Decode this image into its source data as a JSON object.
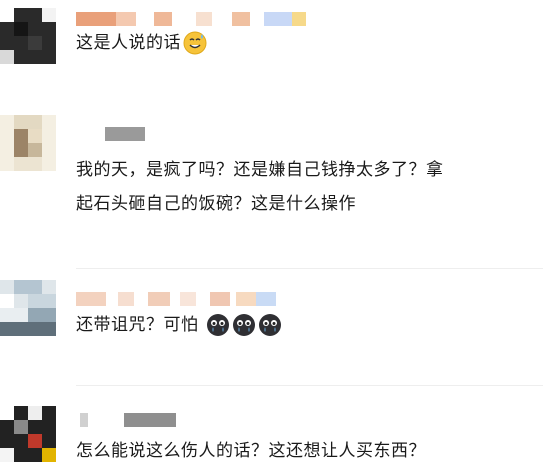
{
  "comments": [
    {
      "text": "这是人说的话",
      "emojis": [
        "sweat-smile-emoji"
      ]
    },
    {
      "lines": [
        "我的天，是疯了吗？还是嫌自己钱挣太多了？拿",
        "起石头砸自己的饭碗？这是什么操作"
      ],
      "emojis": []
    },
    {
      "text": "还带诅咒？可怕",
      "emojis": [
        "crying-ghost-emoji",
        "crying-ghost-emoji",
        "crying-ghost-emoji"
      ]
    },
    {
      "text": "怎么能说这么伤人的话？这还想让人买东西？",
      "emojis": []
    }
  ],
  "colors": {
    "text": "#1a1a1a",
    "divider": "#eeeeee",
    "background": "#ffffff"
  }
}
